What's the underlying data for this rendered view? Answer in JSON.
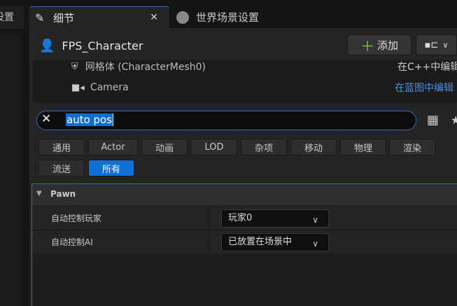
{
  "left_tab": {
    "label": "设置"
  },
  "tabs": [
    {
      "label": "细节",
      "icon": "pencil-icon",
      "active": true
    },
    {
      "label": "世界场景设置",
      "icon": "globe-icon",
      "active": false
    }
  ],
  "header": {
    "title": "FPS_Character",
    "add_label": "添加",
    "add_icon": "plus-icon"
  },
  "components": [
    {
      "label": "网格体 (CharacterMesh0)",
      "icon": "skeletal-mesh-icon",
      "action": "在C++中编辑"
    },
    {
      "label": "Camera",
      "icon": "camera-icon",
      "action": "在蓝图中编辑"
    }
  ],
  "search": {
    "value": "auto pos"
  },
  "filters": [
    "通用",
    "Actor",
    "动画",
    "LOD",
    "杂项",
    "移动",
    "物理",
    "渲染",
    "流送",
    "所有"
  ],
  "selected_filter": "所有",
  "section": {
    "title": "Pawn"
  },
  "properties": [
    {
      "label": "自动控制玩家",
      "value": "玩家0"
    },
    {
      "label": "自动控制AI",
      "value": "已放置在场景中"
    }
  ],
  "colors": {
    "accent": "#0e70d4",
    "add_plus": "#7cc34a",
    "link": "#4a90e2"
  }
}
